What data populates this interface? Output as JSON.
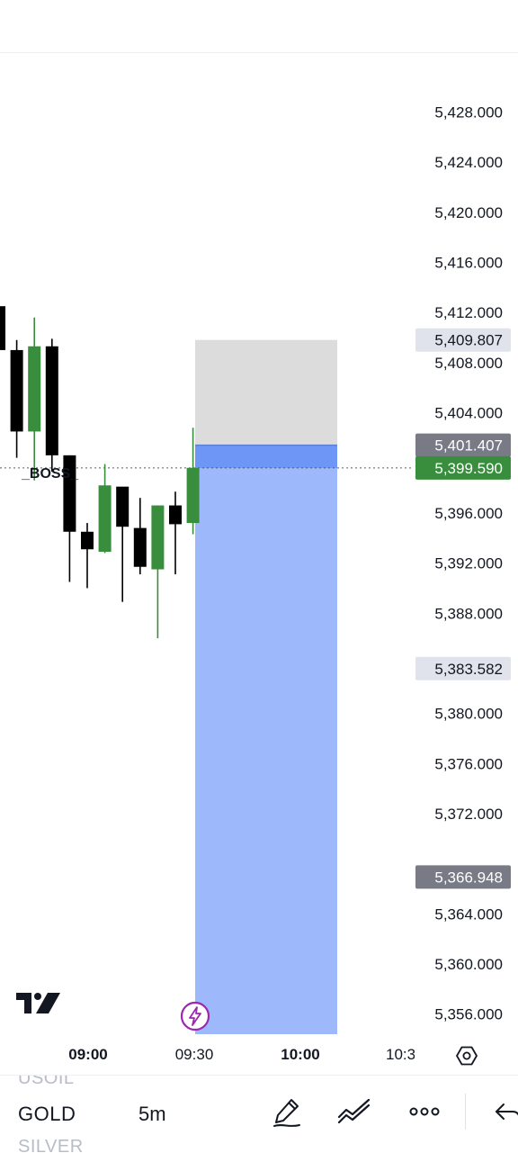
{
  "chart_data": {
    "type": "candlestick",
    "price_axis": {
      "ticks": [
        "5,428.000",
        "5,424.000",
        "5,420.000",
        "5,416.000",
        "5,412.000",
        "5,408.000",
        "5,404.000",
        "5,396.000",
        "5,392.000",
        "5,388.000",
        "5,380.000",
        "5,376.000",
        "5,372.000",
        "5,364.000",
        "5,360.000",
        "5,356.000"
      ],
      "tick_values": [
        5428,
        5424,
        5420,
        5416,
        5412,
        5408,
        5404,
        5396,
        5392,
        5388,
        5380,
        5376,
        5372,
        5364,
        5360,
        5356
      ],
      "visible_range": [
        5354.4,
        5432.7
      ]
    },
    "time_axis": [
      {
        "label": "09:00",
        "bold": true
      },
      {
        "label": "09:30",
        "bold": false
      },
      {
        "label": "10:00",
        "bold": true
      },
      {
        "label": "10:3",
        "bold": false
      }
    ],
    "candles": [
      {
        "open": 5412.5,
        "high": 5413.8,
        "low": 5408.0,
        "close": 5409.0
      },
      {
        "open": 5409.0,
        "high": 5409.8,
        "low": 5400.4,
        "close": 5402.5
      },
      {
        "open": 5402.5,
        "high": 5411.6,
        "low": 5398.6,
        "close": 5409.3
      },
      {
        "open": 5409.3,
        "high": 5409.9,
        "low": 5399.3,
        "close": 5400.6
      },
      {
        "open": 5400.6,
        "high": 5400.6,
        "low": 5390.5,
        "close": 5394.5
      },
      {
        "open": 5394.5,
        "high": 5395.2,
        "low": 5390.0,
        "close": 5393.1
      },
      {
        "open": 5392.9,
        "high": 5399.9,
        "low": 5392.8,
        "close": 5398.2
      },
      {
        "open": 5398.1,
        "high": 5397.5,
        "low": 5388.9,
        "close": 5394.9
      },
      {
        "open": 5394.8,
        "high": 5397.2,
        "low": 5391.1,
        "close": 5391.7
      },
      {
        "open": 5391.5,
        "high": 5396.6,
        "low": 5386.0,
        "close": 5396.6
      },
      {
        "open": 5396.6,
        "high": 5397.7,
        "low": 5391.1,
        "close": 5395.1
      },
      {
        "open": 5395.2,
        "high": 5402.8,
        "low": 5394.3,
        "close": 5399.6
      }
    ],
    "current_price": {
      "label": "5,399.590",
      "value": 5399.59
    },
    "position_tool": {
      "target": {
        "label": "5,409.807",
        "value": 5409.807
      },
      "entry": {
        "label": "5,401.407",
        "value": 5401.407
      },
      "stop": {
        "label": "5,366.948",
        "value": 5366.948
      }
    },
    "marker": {
      "label": "5,383.582",
      "value": 5383.582
    },
    "annotation": "_BOSS_",
    "colors": {
      "up": "#388e3c",
      "down": "#000000",
      "price_badge": "#388e3c",
      "gray_badge": "#787b86",
      "light_badge": "#e0e3eb",
      "target_zone": "#dcdcdc",
      "stop_zone": "#9db8fb",
      "entry_strip": "#6d96f7"
    }
  },
  "toolbar": {
    "symbol_prev": "USOIL",
    "symbol_current": "GOLD",
    "symbol_next": "SILVER",
    "interval": "5m"
  },
  "icons": {
    "settings": "settings-hexagon-icon",
    "logo": "tradingview-logo-icon",
    "bolt": "lightning-bolt-icon",
    "draw": "pen-icon",
    "indicators": "indicators-icon",
    "more": "more-dots-icon",
    "undo": "undo-icon"
  }
}
